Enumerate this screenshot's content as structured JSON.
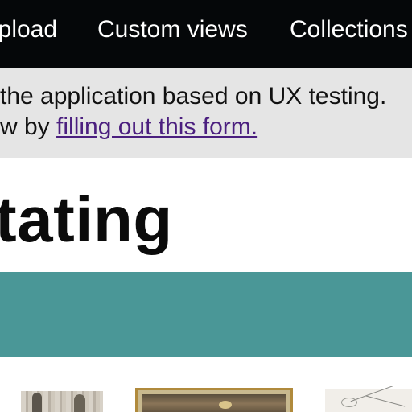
{
  "nav": {
    "items": [
      {
        "label": "Upload"
      },
      {
        "label": "Custom views"
      },
      {
        "label": "Collections"
      }
    ]
  },
  "banner": {
    "line1": "the application based on UX testing.",
    "line2_prefix": "w by ",
    "link_text": "filling out this form."
  },
  "page": {
    "title": "tating"
  },
  "colors": {
    "nav_bg": "#050709",
    "banner_bg": "#e5e5e5",
    "link": "#4b1f7f",
    "teal": "#4a9797"
  }
}
